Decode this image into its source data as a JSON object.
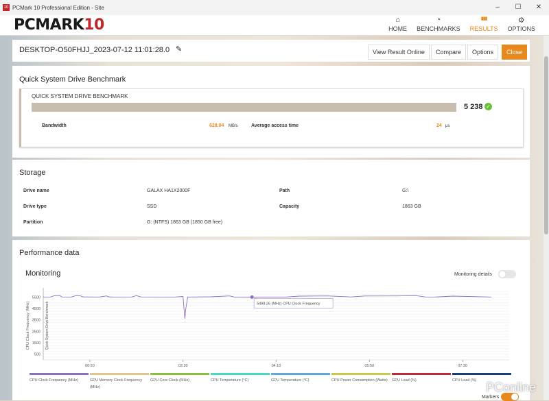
{
  "window": {
    "title": "PCMark 10 Professional Edition - Site",
    "app_icon": "10",
    "controls": [
      "–",
      "☐",
      "✕"
    ]
  },
  "header": {
    "logo_text": "PCMARK",
    "logo_num": "10",
    "nav": [
      {
        "label": "HOME",
        "icon": "home-icon",
        "glyph": "⌂"
      },
      {
        "label": "BENCHMARKS",
        "icon": "gauge-icon",
        "glyph": "◔"
      },
      {
        "label": "RESULTS",
        "icon": "bar-chart-icon",
        "glyph": "▮▮▮",
        "active": true
      },
      {
        "label": "OPTIONS",
        "icon": "gear-icon",
        "glyph": "⚙"
      }
    ],
    "accent": "#e8891e"
  },
  "result": {
    "name": "DESKTOP-O50FHJJ_2023-07-12 11:01:28.0",
    "edit_glyph": "✎",
    "buttons": {
      "view_online": "View Result Online",
      "compare": "Compare",
      "options": "Options",
      "close": "Close"
    }
  },
  "benchmark": {
    "section_title": "Quick System Drive Benchmark",
    "name": "QUICK SYSTEM DRIVE BENCHMARK",
    "score": "5 238",
    "check_glyph": "✓",
    "bandwidth_label": "Bandwidth",
    "bandwidth_value": "628.04",
    "bandwidth_unit": "MB/s",
    "access_label": "Average access time",
    "access_value": "24",
    "access_unit": "μs"
  },
  "storage": {
    "section_title": "Storage",
    "drive_name_label": "Drive name",
    "drive_name": "GALAX HA1X2000F",
    "path_label": "Path",
    "path": "G:\\",
    "drive_type_label": "Drive type",
    "drive_type": "SSD",
    "capacity_label": "Capacity",
    "capacity": "1863 GB",
    "partition_label": "Partition",
    "partition": "G: (NTFS) 1863 GB (1850 GB free)"
  },
  "performance": {
    "section_title": "Performance data",
    "monitoring_title": "Monitoring",
    "monitoring_details_label": "Monitoring details",
    "monitoring_details_on": false,
    "markers_label": "Markers",
    "markers_on": true,
    "watermark": "PConline"
  },
  "chart_data": {
    "type": "line",
    "ylabel": "CPU Clock Frequency (MHz)",
    "ylabel2": "Quick System Drive Benchmark",
    "yticks": [
      500,
      1500,
      2500,
      3500,
      4500,
      5500
    ],
    "ylim": [
      0,
      6000
    ],
    "xticks": [
      "00:50",
      "02:30",
      "04:10",
      "05:50",
      "07:30"
    ],
    "xtick_seconds": [
      50,
      150,
      250,
      350,
      450
    ],
    "xlim": [
      0,
      500
    ],
    "grid": true,
    "tooltip": {
      "x": 224,
      "y": 5498.26,
      "text": "5498.26 (MHz) CPU Clock Frequency"
    },
    "series": [
      {
        "name": "CPU Clock Frequency (MHz)",
        "color": "#8a6fc0",
        "x": [
          0,
          8,
          12,
          15,
          18,
          20,
          30,
          35,
          40,
          43,
          60,
          68,
          70,
          75,
          95,
          100,
          105,
          140,
          150,
          151,
          152,
          153,
          155,
          180,
          200,
          205,
          215,
          224,
          260,
          275,
          305,
          330,
          345,
          380,
          400,
          410,
          420,
          440,
          481
        ],
        "y": [
          5500,
          5510,
          5620,
          5600,
          5620,
          5510,
          5500,
          5620,
          5600,
          5510,
          5500,
          5600,
          5520,
          5500,
          5510,
          5620,
          5510,
          5500,
          5550,
          4500,
          3600,
          4500,
          5500,
          5520,
          5600,
          5500,
          5500,
          5498,
          5500,
          5580,
          5600,
          5510,
          5590,
          5600,
          5620,
          5510,
          5500,
          5580,
          5500
        ]
      },
      {
        "name": "GPU Memory Clock Frequency (MHz)",
        "color": "#e2c48d"
      },
      {
        "name": "GPU Core Clock (MHz)",
        "color": "#8bbf3f"
      },
      {
        "name": "CPU Temperature (°C)",
        "color": "#48d8c0"
      },
      {
        "name": "GPU Temperature (°C)",
        "color": "#5fa8e0"
      },
      {
        "name": "CPU Power Consumption (Watts)",
        "color": "#c8c848"
      },
      {
        "name": "GPU Load (%)",
        "color": "#c0273a"
      },
      {
        "name": "CPU Load (%)",
        "color": "#173f7a"
      }
    ]
  }
}
